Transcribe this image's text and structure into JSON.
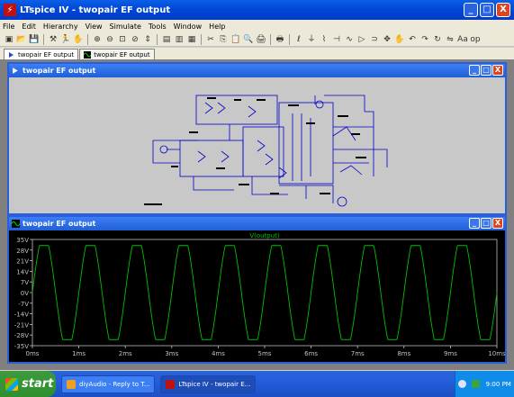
{
  "window": {
    "title": "LTspice IV - twopair EF output",
    "controls": [
      "_",
      "□",
      "X"
    ]
  },
  "menu": [
    "File",
    "Edit",
    "Hierarchy",
    "View",
    "Simulate",
    "Tools",
    "Window",
    "Help"
  ],
  "toolbar": {
    "icons": [
      "new-schematic-icon",
      "open-icon",
      "save-icon",
      "control-panel-icon",
      "run-icon",
      "halt-icon",
      "zoom-in-icon",
      "zoom-out-icon",
      "zoom-fit-icon",
      "zoom-cancel-icon",
      "autorange-icon",
      "tile-icon",
      "cascade-icon",
      "close-all-icon",
      "cut-icon",
      "copy-icon",
      "paste-icon",
      "find-icon",
      "print-icon",
      "print-preview-icon",
      "wire-icon",
      "ground-icon",
      "resistor-icon",
      "capacitor-icon",
      "inductor-icon",
      "diode-icon",
      "component-icon",
      "move-icon",
      "drag-icon",
      "undo-icon",
      "redo-icon",
      "rotate-icon",
      "mirror-icon",
      "text-icon",
      "spice-directive-icon"
    ],
    "glyphs": [
      "▣",
      "📂",
      "💾",
      "⚒",
      "🏃",
      "✋",
      "⊕",
      "⊖",
      "⊡",
      "⊘",
      "⇕",
      "▤",
      "▥",
      "▦",
      "✂",
      "⎘",
      "📋",
      "🔍",
      "🖨",
      "🖶",
      "ℓ",
      "⏚",
      "⌇",
      "⊣",
      "∿",
      "▷",
      "⊃",
      "✥",
      "✋",
      "↶",
      "↷",
      "↻",
      "⇋",
      "Aa",
      "op"
    ]
  },
  "tabs": [
    {
      "label": "twopair EF output",
      "active": true
    },
    {
      "label": "twopair EF output",
      "active": false
    }
  ],
  "schematic_window": {
    "title": "twopair EF output"
  },
  "plot_window": {
    "title": "twopair EF output"
  },
  "chart_data": {
    "type": "line",
    "title": "V(output)",
    "series": [
      {
        "name": "V(output)",
        "color": "#00c000",
        "frequency_khz": 1,
        "amplitude": 31,
        "clip_low": -31,
        "clip_high": 31
      }
    ],
    "y_ticks": [
      "35V",
      "28V",
      "21V",
      "14V",
      "7V",
      "0V",
      "-7V",
      "-14V",
      "-21V",
      "-28V",
      "-35V"
    ],
    "y_values": [
      35,
      28,
      21,
      14,
      7,
      0,
      -7,
      -14,
      -21,
      -28,
      -35
    ],
    "x_ticks": [
      "0ms",
      "1ms",
      "2ms",
      "3ms",
      "4ms",
      "5ms",
      "6ms",
      "7ms",
      "8ms",
      "9ms",
      "10ms"
    ],
    "x_values": [
      0,
      1,
      2,
      3,
      4,
      5,
      6,
      7,
      8,
      9,
      10
    ],
    "xlim": [
      0,
      10
    ],
    "ylim": [
      -35,
      35
    ],
    "colors": {
      "background": "#000000",
      "trace": "#00c000",
      "axis": "#c0c0c0",
      "grid": "#303030"
    }
  },
  "taskbar": {
    "start": "start",
    "tasks": [
      {
        "label": "diyAudio - Reply to T...",
        "active": false
      },
      {
        "label": "LTspice IV - twopair E...",
        "active": true
      }
    ],
    "clock": "9:00 PM"
  }
}
